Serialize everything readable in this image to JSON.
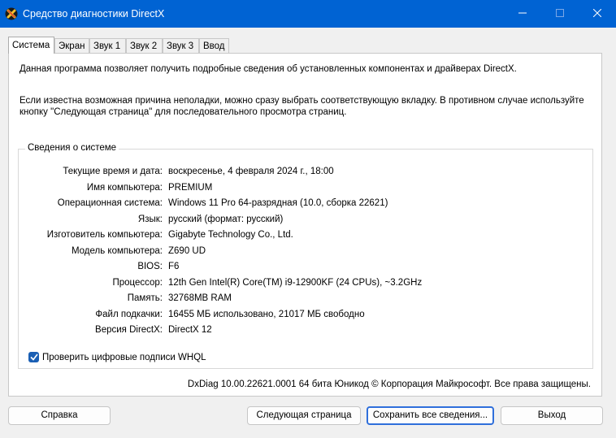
{
  "window": {
    "title": "Средство диагностики DirectX",
    "icon": "directx-icon",
    "accent": "#0063d3"
  },
  "tabs": [
    {
      "label": "Система",
      "active": true
    },
    {
      "label": "Экран"
    },
    {
      "label": "Звук 1"
    },
    {
      "label": "Звук 2"
    },
    {
      "label": "Звук 3"
    },
    {
      "label": "Ввод"
    }
  ],
  "intro": {
    "line1": "Данная программа позволяет получить подробные сведения об установленных компонентах и драйверах DirectX.",
    "line2": "Если известна возможная причина неполадки, можно сразу выбрать соответствующую вкладку. В противном случае используйте кнопку \"Следующая страница\" для последовательного просмотра страниц."
  },
  "system_info": {
    "title": "Сведения о системе",
    "rows": [
      {
        "label": "Текущие время и дата:",
        "value": "воскресенье, 4 февраля 2024 г., 18:00"
      },
      {
        "label": "Имя компьютера:",
        "value": "PREMIUM"
      },
      {
        "label": "Операционная система:",
        "value": "Windows 11 Pro 64-разрядная (10.0, сборка 22621)"
      },
      {
        "label": "Язык:",
        "value": "русский (формат: русский)"
      },
      {
        "label": "Изготовитель компьютера:",
        "value": "Gigabyte Technology Co., Ltd."
      },
      {
        "label": "Модель компьютера:",
        "value": "Z690 UD"
      },
      {
        "label": "BIOS:",
        "value": "F6"
      },
      {
        "label": "Процессор:",
        "value": "12th Gen Intel(R) Core(TM) i9-12900KF (24 CPUs), ~3.2GHz"
      },
      {
        "label": "Память:",
        "value": "32768MB RAM"
      },
      {
        "label": "Файл подкачки:",
        "value": "16455 МБ использовано, 21017 МБ свободно"
      },
      {
        "label": "Версия DirectX:",
        "value": "DirectX 12"
      }
    ]
  },
  "whql": {
    "label": "Проверить цифровые подписи WHQL",
    "checked": true
  },
  "footer": "DxDiag 10.00.22621.0001 64 бита Юникод © Корпорация Майкрософт. Все права защищены.",
  "buttons": {
    "help": "Справка",
    "next": "Следующая страница",
    "save": "Сохранить все сведения...",
    "exit": "Выход"
  }
}
